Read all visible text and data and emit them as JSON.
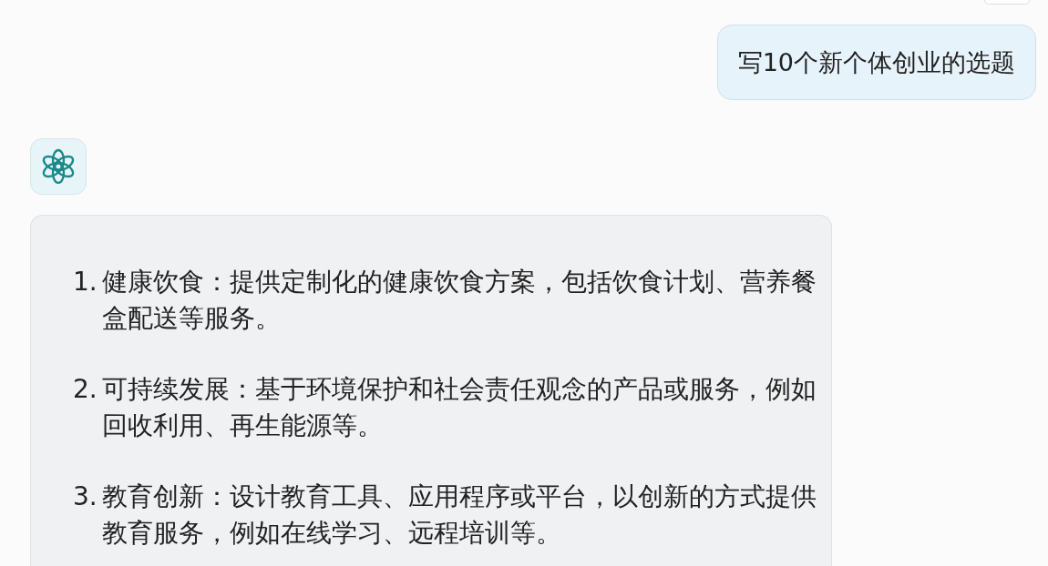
{
  "user_message": {
    "text": "写10个新个体创业的选题"
  },
  "assistant_message": {
    "items": [
      {
        "number": "1.",
        "text": "健康饮食：提供定制化的健康饮食方案，包括饮食计划、营养餐盒配送等服务。"
      },
      {
        "number": "2.",
        "text": "可持续发展：基于环境保护和社会责任观念的产品或服务，例如回收利用、再生能源等。"
      },
      {
        "number": "3.",
        "text": "教育创新：设计教育工具、应用程序或平台，以创新的方式提供教育服务，例如在线学习、远程培训等。"
      }
    ]
  }
}
